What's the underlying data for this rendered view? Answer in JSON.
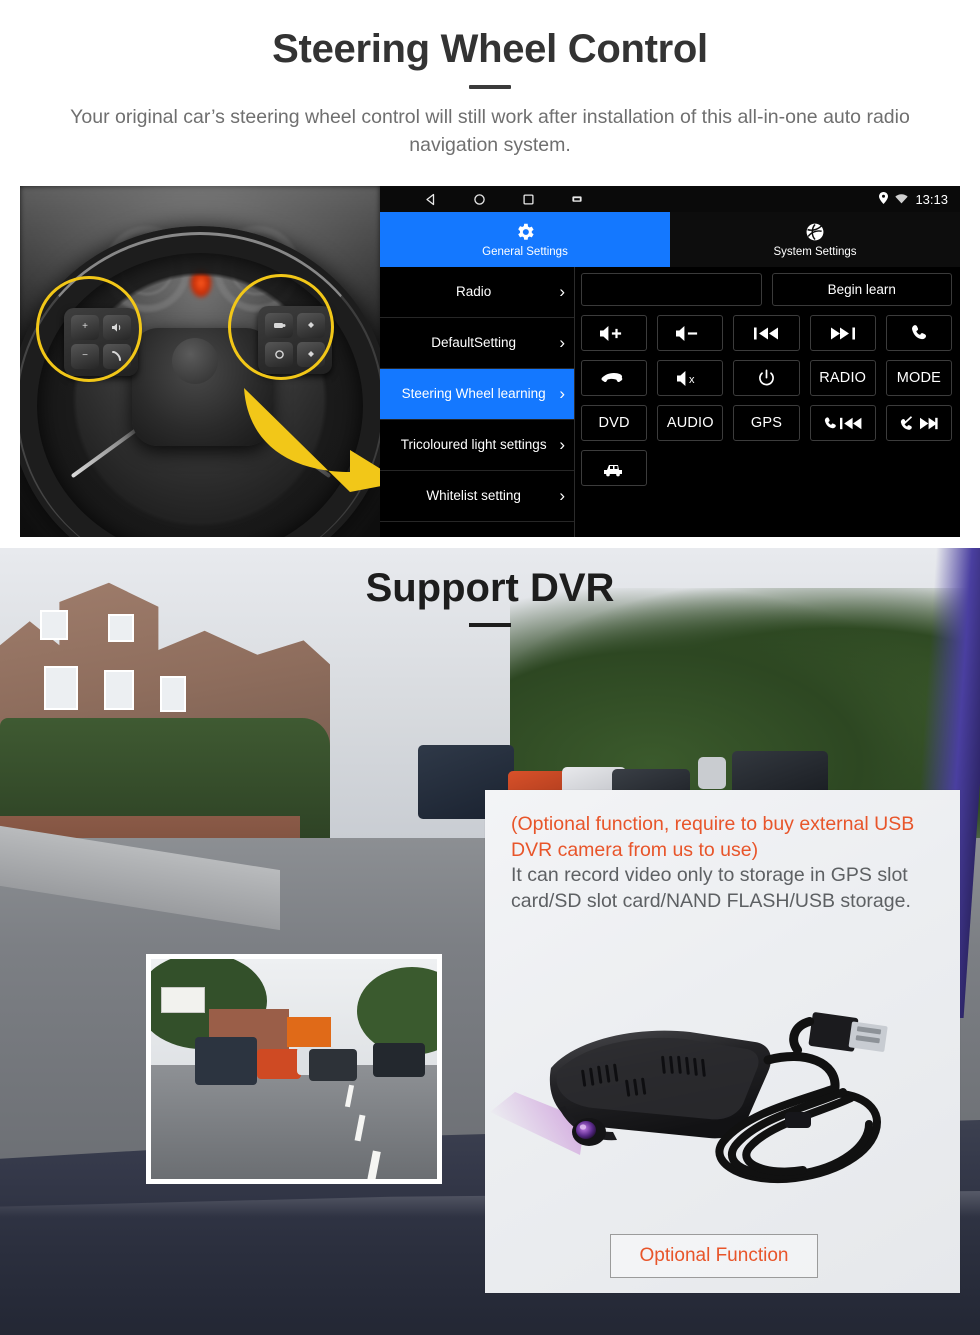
{
  "section1": {
    "title": "Steering Wheel Control",
    "subtitle": "Your original car’s steering wheel control will still work after installation of this all-in-one auto radio navigation system."
  },
  "head_unit": {
    "statusbar": {
      "nav_back": "back-icon",
      "nav_home": "home-icon",
      "nav_recents": "recents-icon",
      "nav_screenshot": "screenshot-icon",
      "gps_icon": "location-pin-icon",
      "wifi_icon": "wifi-icon",
      "clock": "13:13"
    },
    "tabs": [
      {
        "label": "General Settings",
        "icon": "gear-icon",
        "active": true
      },
      {
        "label": "System Settings",
        "icon": "android-system-icon",
        "active": false
      }
    ],
    "menu": [
      {
        "label": "Radio",
        "active": false
      },
      {
        "label": "DefaultSetting",
        "active": false
      },
      {
        "label": "Steering Wheel learning",
        "active": true
      },
      {
        "label": "Tricoloured light settings",
        "active": false
      },
      {
        "label": "Whitelist setting",
        "active": false
      }
    ],
    "learn_input_value": "",
    "learn_button": "Begin learn",
    "keys": [
      {
        "id": "vol-up",
        "label": "",
        "icon": "volume-up-icon"
      },
      {
        "id": "vol-down",
        "label": "",
        "icon": "volume-down-icon"
      },
      {
        "id": "prev-track",
        "label": "",
        "icon": "previous-track-icon"
      },
      {
        "id": "next-track",
        "label": "",
        "icon": "next-track-icon"
      },
      {
        "id": "call-answer",
        "label": "",
        "icon": "phone-answer-icon"
      },
      {
        "id": "call-hangup",
        "label": "",
        "icon": "phone-hangup-icon"
      },
      {
        "id": "mute",
        "label": "",
        "icon": "volume-mute-icon"
      },
      {
        "id": "power",
        "label": "",
        "icon": "power-icon"
      },
      {
        "id": "radio",
        "label": "RADIO",
        "icon": ""
      },
      {
        "id": "mode",
        "label": "MODE",
        "icon": ""
      },
      {
        "id": "dvd",
        "label": "DVD",
        "icon": ""
      },
      {
        "id": "audio",
        "label": "AUDIO",
        "icon": ""
      },
      {
        "id": "gps",
        "label": "GPS",
        "icon": ""
      },
      {
        "id": "call-prev",
        "label": "",
        "icon": "phone-previous-icon"
      },
      {
        "id": "call-next",
        "label": "",
        "icon": "phone-reject-next-icon"
      },
      {
        "id": "car-info",
        "label": "",
        "icon": "car-icon"
      }
    ]
  },
  "section2": {
    "title": "Support DVR",
    "note_orange": "(Optional function, require to buy external USB DVR camera from us to use)",
    "note_grey": "It can record video only to storage in GPS slot card/SD slot card/NAND FLASH/USB storage.",
    "optional_button": "Optional Function"
  },
  "colors": {
    "accent_blue": "#1478ff",
    "accent_orange": "#e8552a",
    "highlight_yellow": "#f2c718",
    "title_dark": "#333333",
    "body_grey": "#6f6f6f"
  }
}
